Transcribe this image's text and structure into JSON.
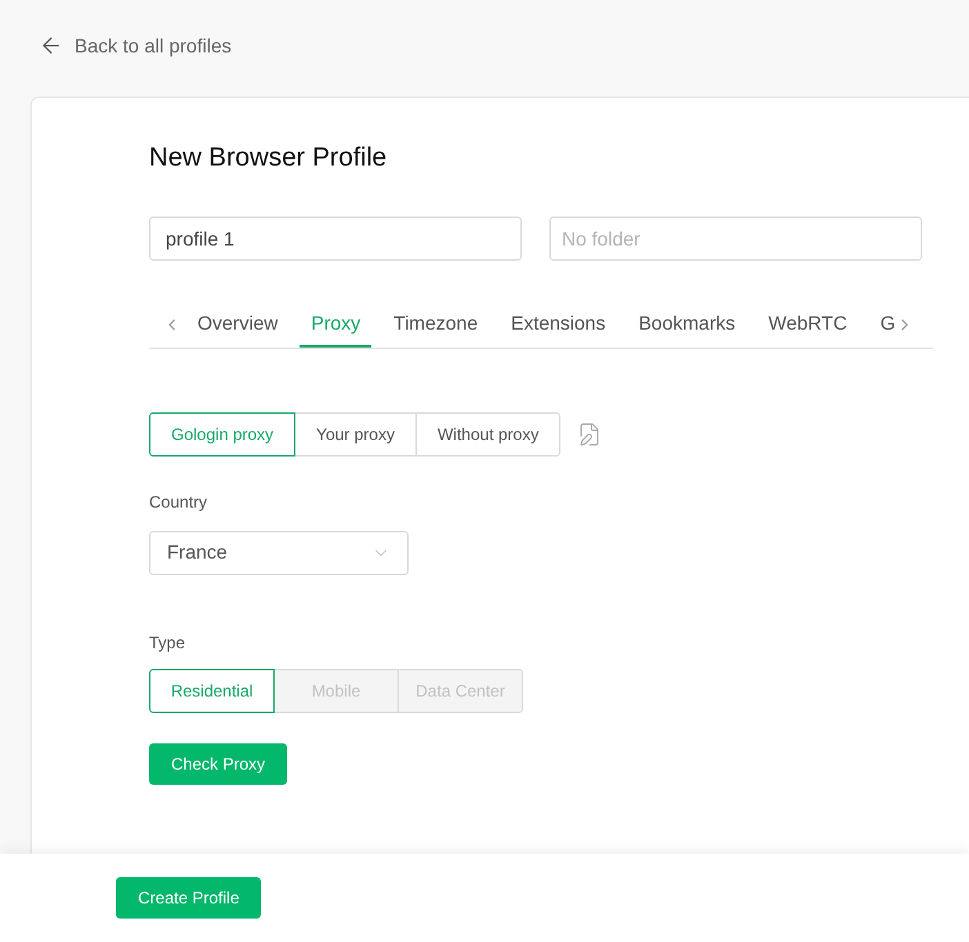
{
  "back_link": "Back to all profiles",
  "title": "New Browser Profile",
  "name_field": {
    "value": "profile 1"
  },
  "folder_field": {
    "placeholder": "No folder"
  },
  "tabs": [
    {
      "label": "Overview",
      "selected": false
    },
    {
      "label": "Proxy",
      "selected": true
    },
    {
      "label": "Timezone",
      "selected": false
    },
    {
      "label": "Extensions",
      "selected": false
    },
    {
      "label": "Bookmarks",
      "selected": false
    },
    {
      "label": "WebRTC",
      "selected": false
    },
    {
      "label": "G",
      "selected": false
    }
  ],
  "proxy_modes": [
    {
      "label": "Gologin proxy",
      "selected": true
    },
    {
      "label": "Your proxy",
      "selected": false
    },
    {
      "label": "Without proxy",
      "selected": false
    }
  ],
  "country": {
    "label": "Country",
    "value": "France"
  },
  "type": {
    "label": "Type",
    "options": [
      {
        "label": "Residential",
        "selected": true,
        "disabled": false
      },
      {
        "label": "Mobile",
        "selected": false,
        "disabled": true
      },
      {
        "label": "Data Center",
        "selected": false,
        "disabled": true
      }
    ]
  },
  "check_button": "Check Proxy",
  "create_button": "Create Profile"
}
